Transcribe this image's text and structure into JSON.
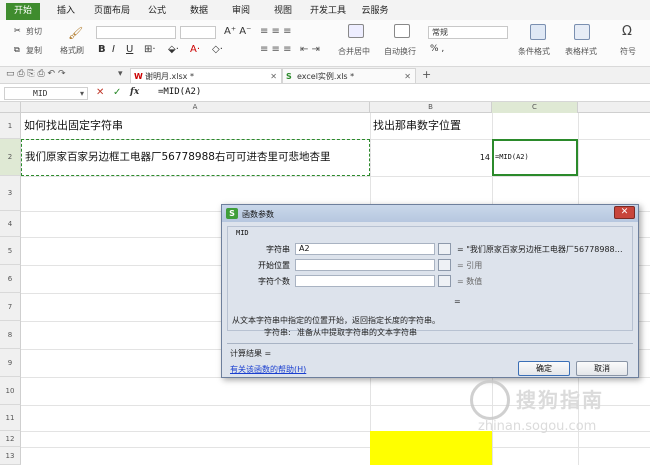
{
  "menu": {
    "tabs": [
      "开始",
      "插入",
      "页面布局",
      "公式",
      "数据",
      "审阅",
      "视图",
      "开发工具",
      "云服务"
    ]
  },
  "ribbon": {
    "cut": "剪切",
    "copy": "复制",
    "format_painter": "格式刷",
    "number_format": "常规",
    "merge_center": "合并居中",
    "wrap_text": "自动换行",
    "cond_format": "条件格式",
    "table_style": "表格样式",
    "symbol": "符号",
    "percent": "% ,"
  },
  "doc_tabs": [
    {
      "label": "谢明月.xlsx *",
      "active": true
    },
    {
      "label": "excel实例.xls *",
      "active": false
    }
  ],
  "formula_bar": {
    "name_box": "MID",
    "fx": "fx",
    "formula": "=MID(A2)"
  },
  "grid": {
    "columns": [
      "A",
      "B",
      "C"
    ],
    "rows": [
      "1",
      "2",
      "3",
      "4",
      "5",
      "6",
      "7",
      "8",
      "9",
      "10",
      "11",
      "12",
      "13"
    ],
    "a1": "如何找出固定字符串",
    "b1": "找出那串数字位置",
    "a2": "我们原家百家另边框工电器厂56778988右可可进杏里可悲地杏里",
    "b2": "14",
    "c2": "=MID(A2)"
  },
  "dialog": {
    "title": "函数参数",
    "function_name": "MID",
    "args": [
      {
        "label": "字符串",
        "value": "A2",
        "result": "= \"我们原家百家另边框工电器厂56778988…"
      },
      {
        "label": "开始位置",
        "value": "",
        "result": "= 引用"
      },
      {
        "label": "字符个数",
        "value": "",
        "result": "= 数值"
      }
    ],
    "equals_line": "=",
    "description": "从文本字符串中指定的位置开始，返回指定长度的字符串。",
    "arg_help_label": "字符串:",
    "arg_help_text": "准备从中提取字符串的文本字符串",
    "calc_result": "计算结果 =",
    "help_link": "有关该函数的帮助(H)",
    "ok": "确定",
    "cancel": "取消"
  },
  "watermark": {
    "brand": "搜狗指南",
    "url": "zhinan.sogou.com"
  },
  "colors": {
    "accent_green": "#3f8c2e",
    "selection_green": "#2b8a2b",
    "highlight_yellow": "#ffff00"
  }
}
